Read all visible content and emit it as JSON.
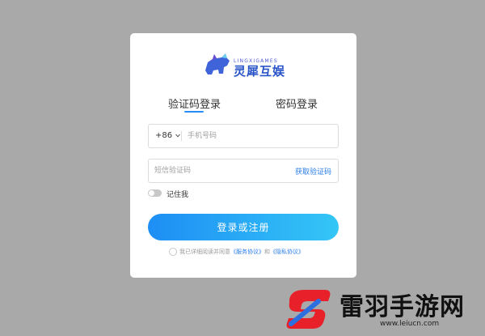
{
  "logo": {
    "subtitle": "LINGXIGAMES",
    "title": "灵犀互娱",
    "color": "#2a55c8"
  },
  "tabs": [
    {
      "label": "验证码登录",
      "active": true
    },
    {
      "label": "密码登录",
      "active": false
    }
  ],
  "phone": {
    "country_code": "+86",
    "chevron": "chevron-down-icon",
    "placeholder": "手机号码",
    "value": ""
  },
  "code": {
    "placeholder": "短信验证码",
    "value": "",
    "get_code_label": "获取验证码"
  },
  "remember": {
    "label": "记住我",
    "on": false
  },
  "submit": {
    "label": "登录或注册"
  },
  "agreement": {
    "prefix": "我已详细阅读并同意",
    "service_link": "《服务协议》",
    "and": "和",
    "privacy_link": "《隐私协议》"
  },
  "watermark": {
    "text": "雷羽手游网",
    "url": "www.leiucn.com"
  },
  "colors": {
    "accent": "#2b8cf3",
    "button_start": "#1e8ef5",
    "button_end": "#34c6f6",
    "link": "#2b7de9"
  }
}
